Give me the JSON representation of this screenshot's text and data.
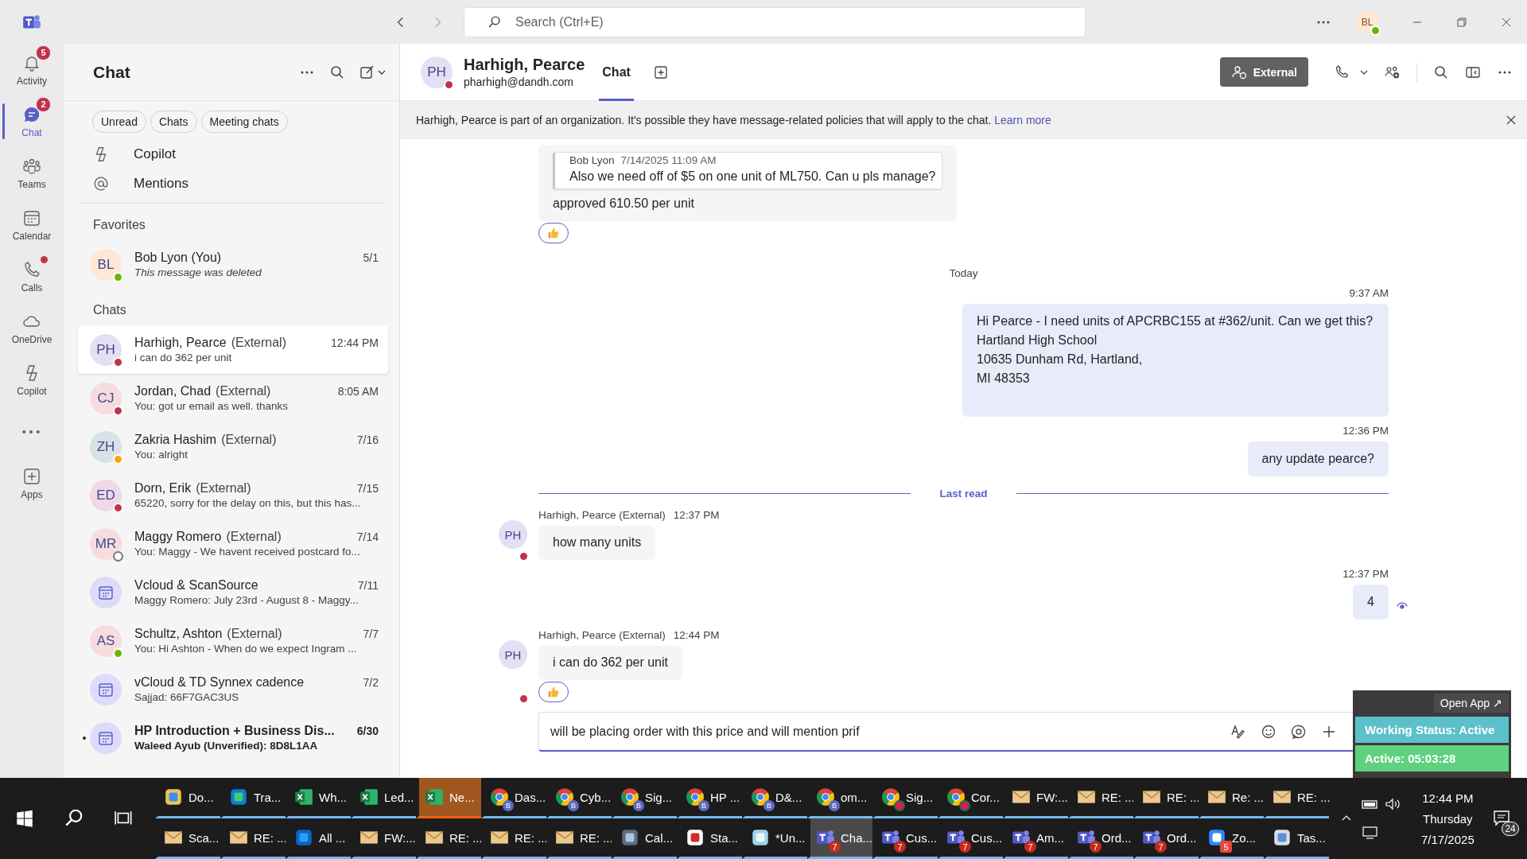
{
  "top_bar": {
    "search": {
      "placeholder": "Search (Ctrl+E)"
    },
    "user": {
      "initials": "BL",
      "presence": {
        "kind": "available"
      }
    }
  },
  "rail": [
    {
      "label": "Activity",
      "kind": "activity",
      "badge": "5",
      "dot": false,
      "selected": false
    },
    {
      "label": "Chat",
      "kind": "chat",
      "badge": "2",
      "dot": false,
      "selected": true
    },
    {
      "label": "Teams",
      "kind": "teams",
      "dot": false,
      "selected": false
    },
    {
      "label": "Calendar",
      "kind": "calendar",
      "dot": false,
      "selected": false
    },
    {
      "label": "Calls",
      "kind": "calls",
      "dot": true,
      "selected": false
    },
    {
      "label": "OneDrive",
      "kind": "onedrive",
      "dot": false,
      "selected": false
    },
    {
      "label": "Copilot",
      "kind": "copilot",
      "dot": false,
      "selected": false
    },
    {
      "kind": "more",
      "dot": false,
      "selected": false
    },
    {
      "label": "Apps",
      "kind": "apps",
      "dot": false,
      "selected": false
    }
  ],
  "chat_list": {
    "title": "Chat",
    "filters": [
      {
        "label": "Unread"
      },
      {
        "label": "Chats"
      },
      {
        "label": "Meeting chats"
      }
    ],
    "shortcuts": [
      {
        "label": "Copilot",
        "kind": "copilot"
      },
      {
        "label": "Mentions",
        "kind": "mentions"
      }
    ],
    "favorites_heading": "Favorites",
    "favorites": [
      {
        "name": "Bob Lyon (You)",
        "preview": "This message was deleted",
        "deleted": true,
        "time": "5/1",
        "avatar": {
          "kind": "person",
          "initials": "BL",
          "color": "#fde7d6"
        },
        "presence": {
          "kind": "available"
        },
        "selected": false,
        "unread": false
      }
    ],
    "chats_heading": "Chats",
    "chats": [
      {
        "name": "Harhigh, Pearce",
        "tag": "(External)",
        "preview": "i can do 362 per unit",
        "time": "12:44 PM",
        "avatar": {
          "kind": "person",
          "initials": "PH",
          "color": "#e3e0f3"
        },
        "presence": {
          "kind": "busy"
        },
        "selected": true,
        "unread": false
      },
      {
        "name": "Jordan, Chad",
        "tag": "(External)",
        "preview": "You: got ur email as well. thanks",
        "time": "8:05 AM",
        "avatar": {
          "kind": "person",
          "initials": "CJ",
          "color": "#f6dcdf"
        },
        "presence": {
          "kind": "busy"
        },
        "selected": false,
        "unread": false
      },
      {
        "name": "Zakria Hashim",
        "tag": "(External)",
        "preview": "You: alright",
        "time": "7/16",
        "avatar": {
          "kind": "person",
          "initials": "ZH",
          "color": "#d6e2e7"
        },
        "presence": {
          "kind": "away"
        },
        "selected": false,
        "unread": false
      },
      {
        "name": "Dorn, Erik",
        "tag": "(External)",
        "preview": "65220, sorry for the delay on this, but this has...",
        "time": "7/15",
        "avatar": {
          "kind": "person",
          "initials": "ED",
          "color": "#efd9e9"
        },
        "presence": {
          "kind": "busy"
        },
        "selected": false,
        "unread": false
      },
      {
        "name": "Maggy Romero",
        "tag": "(External)",
        "preview": "You: Maggy - We havent received postcard fo...",
        "time": "7/14",
        "avatar": {
          "kind": "person",
          "initials": "MR",
          "color": "#f6dcdf"
        },
        "presence": {
          "kind": "offline"
        },
        "selected": false,
        "unread": false
      },
      {
        "name": "Vcloud & ScanSource",
        "preview": "Maggy Romero: July 23rd - August 8 - Maggy...",
        "time": "7/11",
        "avatar": {
          "kind": "meeting",
          "color": "#dcdcfa"
        },
        "selected": false,
        "unread": false
      },
      {
        "name": "Schultz, Ashton",
        "tag": "(External)",
        "preview": "You: Hi Ashton -  When do we expect Ingram ...",
        "time": "7/7",
        "avatar": {
          "kind": "person",
          "initials": "AS",
          "color": "#f6dcdf"
        },
        "presence": {
          "kind": "available"
        },
        "selected": false,
        "unread": false
      },
      {
        "name": "vCloud & TD Synnex cadence",
        "preview": "Sajjad: 66F7GAC3US",
        "time": "7/2",
        "avatar": {
          "kind": "meeting",
          "color": "#dcdcfa"
        },
        "selected": false,
        "unread": false
      },
      {
        "name": "HP Introduction + Business Dis...",
        "preview": "Waleed Ayub (Unverified): 8D8L1AA",
        "time": "6/30",
        "avatar": {
          "kind": "meeting",
          "color": "#dcdcfa"
        },
        "selected": false,
        "unread": true
      }
    ]
  },
  "conversation": {
    "avatar": {
      "initials": "PH",
      "presence": {
        "kind": "busy"
      }
    },
    "name": "Harhigh, Pearce",
    "email": "pharhigh@dandh.com",
    "tabs": [
      {
        "label": "Chat",
        "selected": true
      }
    ],
    "external_button": "External",
    "banner": {
      "text": "Harhigh, Pearce is part of an organization. It's possible they have message-related policies that will apply to the chat.",
      "link": "Learn more"
    },
    "messages": [
      {
        "kind": "incoming",
        "quote": {
          "author": "Bob Lyon",
          "time": "7/14/2025 11:09 AM",
          "text": "Also we need off of $5 on one unit of ML750. Can u pls manage?"
        },
        "text": "approved 610.50 per unit",
        "reacted": true
      },
      {
        "kind": "date",
        "label": "Today"
      },
      {
        "kind": "outgoing",
        "time": "9:37 AM",
        "text": "Hi Pearce -  I need units of APCRBC155 at #362/unit. Can we get this?\nHartland High School\n10635 Dunham Rd, Hartland,\nMI 48353",
        "seen": false
      },
      {
        "kind": "outgoing",
        "time": "12:36 PM",
        "text": "any update pearce?",
        "seen": false
      },
      {
        "kind": "last_read",
        "label": "Last read"
      },
      {
        "kind": "incoming",
        "author": "Harhigh, Pearce (External)",
        "time": "12:37 PM",
        "avatar": {
          "initials": "PH",
          "presence": {
            "kind": "busy"
          }
        },
        "text": "how many units",
        "reacted": false
      },
      {
        "kind": "outgoing",
        "time": "12:37 PM",
        "text": "4",
        "seen": true
      },
      {
        "kind": "incoming",
        "author": "Harhigh, Pearce (External)",
        "time": "12:44 PM",
        "avatar": {
          "initials": "PH",
          "presence": {
            "kind": "busy"
          }
        },
        "text": "i can do 362 per unit",
        "reacted": true
      }
    ],
    "compose": {
      "value": "will be placing order with this price and will mention prif"
    }
  },
  "status_widget": {
    "open_app": "Open App ↗",
    "working_status": "Working Status: Active",
    "active_time": "Active: 05:03:28"
  },
  "taskbar": {
    "rows": [
      [
        {
          "kind": "folder",
          "label": "Do...",
          "flashing": false,
          "selected": false
        },
        {
          "kind": "edge",
          "label": "Tra...",
          "flashing": false,
          "selected": false
        },
        {
          "kind": "excel",
          "label": "Wh...",
          "flashing": false,
          "selected": false
        },
        {
          "kind": "excel",
          "label": "Led...",
          "flashing": false,
          "selected": false
        },
        {
          "kind": "excel",
          "label": "Ne...",
          "flashing": true,
          "selected": false
        },
        {
          "kind": "chrome",
          "label": "Das...",
          "profile": "B",
          "flashing": false,
          "selected": false
        },
        {
          "kind": "chrome",
          "label": "Cyb...",
          "profile": "B",
          "flashing": false,
          "selected": false
        },
        {
          "kind": "chrome",
          "label": "Sig...",
          "profile": "B",
          "flashing": false,
          "selected": false
        },
        {
          "kind": "chrome",
          "label": "HP ...",
          "profile": "B",
          "flashing": false,
          "selected": false
        },
        {
          "kind": "chrome",
          "label": "D&...",
          "profile": "B",
          "flashing": false,
          "selected": false
        },
        {
          "kind": "chrome",
          "label": "om...",
          "profile": "B",
          "flashing": false,
          "selected": false
        },
        {
          "kind": "chrome",
          "label": "Sig...",
          "flashing": false,
          "selected": false
        },
        {
          "kind": "chrome",
          "label": "Cor...",
          "flashing": false,
          "selected": false
        },
        {
          "kind": "mail",
          "label": "FW:...",
          "flashing": false,
          "selected": false
        },
        {
          "kind": "mail",
          "label": "RE: ...",
          "flashing": false,
          "selected": false
        },
        {
          "kind": "mail",
          "label": "RE: ...",
          "flashing": false,
          "selected": false
        },
        {
          "kind": "mail",
          "label": "Re: ...",
          "flashing": false,
          "selected": false
        },
        {
          "kind": "mail",
          "label": "RE: ...",
          "flashing": false,
          "selected": false
        }
      ],
      [
        {
          "kind": "mail",
          "label": "Sca...",
          "flashing": false,
          "selected": false
        },
        {
          "kind": "mail",
          "label": "RE: ...",
          "flashing": false,
          "selected": false
        },
        {
          "kind": "outlook",
          "label": "All ...",
          "flashing": false,
          "selected": false
        },
        {
          "kind": "mail",
          "label": "FW:...",
          "flashing": false,
          "selected": false
        },
        {
          "kind": "mail",
          "label": "RE: ...",
          "flashing": false,
          "selected": false
        },
        {
          "kind": "mail",
          "label": "RE: ...",
          "flashing": false,
          "selected": false
        },
        {
          "kind": "mail",
          "label": "RE: ...",
          "flashing": false,
          "selected": false
        },
        {
          "kind": "calculator",
          "label": "Cal...",
          "flashing": false,
          "selected": false
        },
        {
          "kind": "pdf",
          "label": "Sta...",
          "flashing": false,
          "selected": false
        },
        {
          "kind": "notepad",
          "label": "*Un...",
          "flashing": false,
          "selected": false
        },
        {
          "kind": "teams",
          "label": "Cha...",
          "badge": "7",
          "flashing": false,
          "selected": true
        },
        {
          "kind": "teams",
          "label": "Cus...",
          "badge": "7",
          "flashing": false,
          "selected": false
        },
        {
          "kind": "teams",
          "label": "Cus...",
          "badge": "7",
          "flashing": false,
          "selected": false
        },
        {
          "kind": "teams",
          "label": "Am...",
          "badge": "7",
          "flashing": false,
          "selected": false
        },
        {
          "kind": "teams",
          "label": "Ord...",
          "badge": "7",
          "flashing": false,
          "selected": false
        },
        {
          "kind": "teams",
          "label": "Ord...",
          "badge": "7",
          "flashing": false,
          "selected": false
        },
        {
          "kind": "zoom",
          "label": "Zo...",
          "badge": "5",
          "flashing": false,
          "selected": false
        },
        {
          "kind": "taskmgr",
          "label": "Tas...",
          "flashing": false,
          "selected": false
        }
      ]
    ],
    "clock": {
      "time": "12:44 PM",
      "day": "Thursday",
      "date": "7/17/2025"
    },
    "notifications": "24"
  }
}
